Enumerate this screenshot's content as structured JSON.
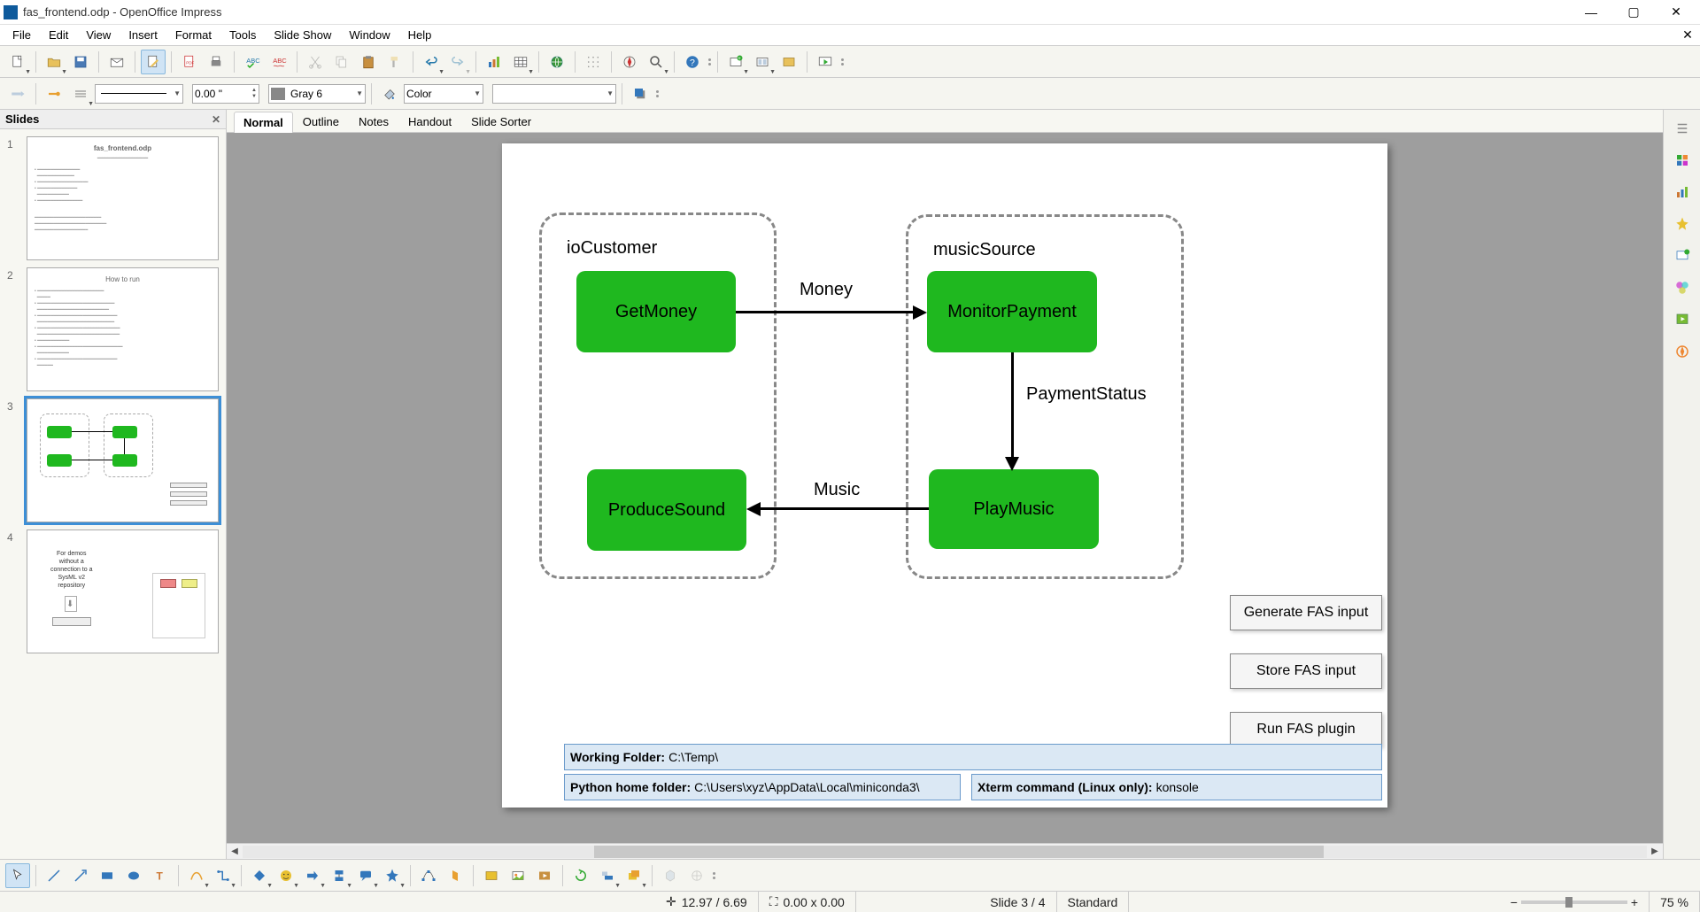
{
  "window": {
    "title": "fas_frontend.odp - OpenOffice Impress"
  },
  "menu": [
    "File",
    "Edit",
    "View",
    "Insert",
    "Format",
    "Tools",
    "Slide Show",
    "Window",
    "Help"
  ],
  "toolbar2": {
    "line_width": "0.00 \"",
    "line_color_label": "Gray 6",
    "fill_type": "Color",
    "fill_value": ""
  },
  "slides_panel": {
    "title": "Slides"
  },
  "slides": [
    {
      "n": "1",
      "title": "fas_frontend.odp"
    },
    {
      "n": "2",
      "title": "How to run"
    },
    {
      "n": "3",
      "title": ""
    },
    {
      "n": "4",
      "line1": "For demos",
      "line2": "without a",
      "line3": "connection to a",
      "line4": "SysML v2",
      "line5": "repository"
    }
  ],
  "view_tabs": [
    "Normal",
    "Outline",
    "Notes",
    "Handout",
    "Slide Sorter"
  ],
  "diagram": {
    "group1": "ioCustomer",
    "group2": "musicSource",
    "box1": "GetMoney",
    "box2": "MonitorPayment",
    "box3": "ProduceSound",
    "box4": "PlayMusic",
    "arrow1": "Money",
    "arrow2": "PaymentStatus",
    "arrow3": "Music",
    "btn1": "Generate FAS input",
    "btn2": "Store FAS input",
    "btn3": "Run FAS plugin",
    "folder_lbl": "Working Folder:",
    "folder_val": "C:\\Temp\\",
    "python_lbl": "Python home folder:",
    "python_val": "C:\\Users\\xyz\\AppData\\Local\\miniconda3\\",
    "xterm_lbl": "Xterm command (Linux only):",
    "xterm_val": "konsole"
  },
  "status": {
    "coords": "12.97 / 6.69",
    "size": "0.00 x 0.00",
    "slide": "Slide 3 / 4",
    "template": "Standard",
    "zoom": "75 %"
  }
}
